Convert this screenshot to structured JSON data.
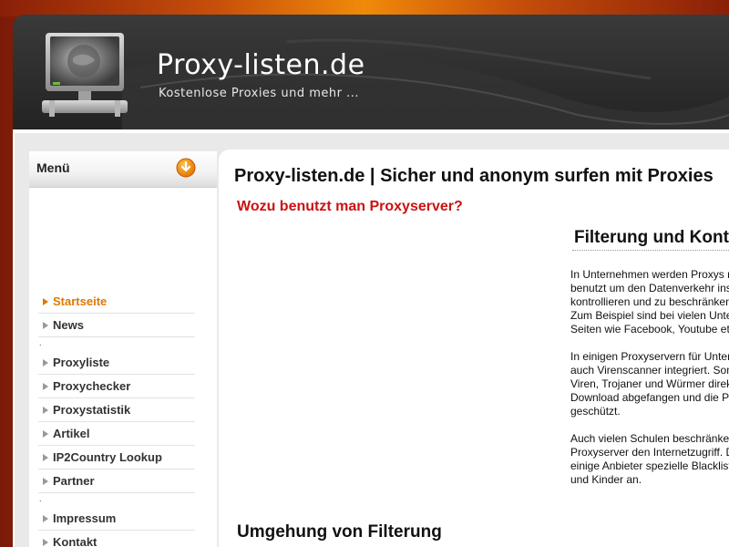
{
  "header": {
    "title": "Proxy-listen.de",
    "subtitle": "Kostenlose Proxies und mehr ..."
  },
  "sidebar": {
    "menu_title": "Menü",
    "separator": ".",
    "items": [
      {
        "label": "Startseite",
        "active": true
      },
      {
        "label": "News"
      },
      {
        "label": "Proxyliste"
      },
      {
        "label": "Proxychecker"
      },
      {
        "label": "Proxystatistik"
      },
      {
        "label": "Artikel"
      },
      {
        "label": "IP2Country Lookup"
      },
      {
        "label": "Partner"
      },
      {
        "label": "Impressum"
      },
      {
        "label": "Kontakt"
      }
    ]
  },
  "content": {
    "heading": "Proxy-listen.de | Sicher und anonym surfen mit Proxies",
    "subheading": "Wozu benutzt man Proxyserver?",
    "column_heading": "Filterung und Kontrolle",
    "paragraphs": [
      [
        "In Unternehmen werden Proxys meist",
        "benutzt um den Datenverkehr ins Internet zu",
        "kontrollieren und zu beschränken.",
        "Zum Beispiel sind bei vielen Unternehmen",
        "Seiten wie Facebook, Youtube etc. gesperrt."
      ],
      [
        "In einigen Proxyservern für Unternehmen ist",
        "auch Virenscanner integriert. Somit werden",
        "Viren, Trojaner und Würmer direkt beim",
        "Download abgefangen und die PCs",
        "geschützt."
      ],
      [
        "Auch vielen Schulen beschränken über",
        "Proxyserver den Internetzugriff. Dabei bieten",
        "einige Anbieter spezielle Blacklists für Schüler",
        "und Kinder an."
      ]
    ],
    "bottom_heading": "Umgehung von Filterung"
  },
  "colors": {
    "accent_orange": "#e07800",
    "heading_red": "#cc1111",
    "header_dark": "#2b2b2b"
  },
  "icons": {
    "logo": "monitor-logo-icon",
    "menu": "orange-circle-down-arrow-icon",
    "bullet": "triangle-right-icon"
  }
}
